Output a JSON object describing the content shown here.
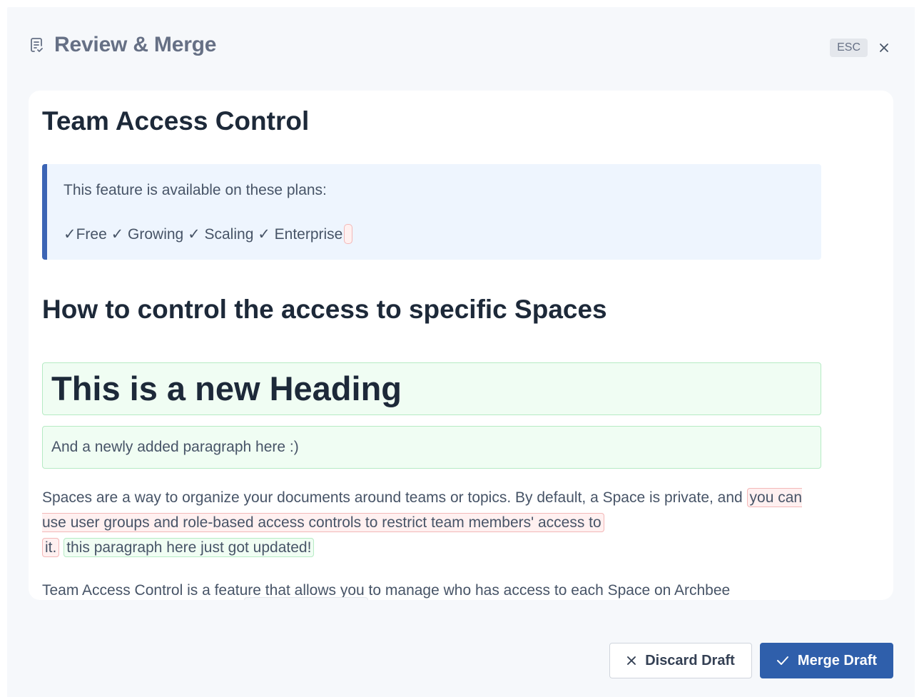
{
  "header": {
    "title": "Review & Merge",
    "title_icon": "document-check-icon",
    "esc_label": "ESC",
    "close_icon": "close-icon"
  },
  "document": {
    "title": "Team Access Control",
    "callout": {
      "line1": "This feature is available on these plans:",
      "line2": "✓Free ✓ Growing ✓ Scaling ✓ Enterprise"
    },
    "section_heading": "How to control the access to specific Spaces",
    "added_heading": "This is a new Heading",
    "added_paragraph": "And a newly added paragraph here :)",
    "paragraph": {
      "text_before": "Spaces are a way to organize your documents around teams or topics. By default, a Space is private, and ",
      "deleted_part1": "you can use user groups and role-based access controls to restrict team members' access to ",
      "deleted_part2": "it.",
      "inserted": "this paragraph here just got updated!"
    },
    "paragraph2": "Team Access Control is a feature that allows you to manage who has access to each Space on Archbee"
  },
  "footer": {
    "discard_label": "Discard Draft",
    "merge_label": "Merge Draft"
  },
  "colors": {
    "primary": "#2f5fab",
    "callout_border": "#3b64b5",
    "insert_bg": "#f0fdf3",
    "delete_bg": "#fff0f0"
  }
}
